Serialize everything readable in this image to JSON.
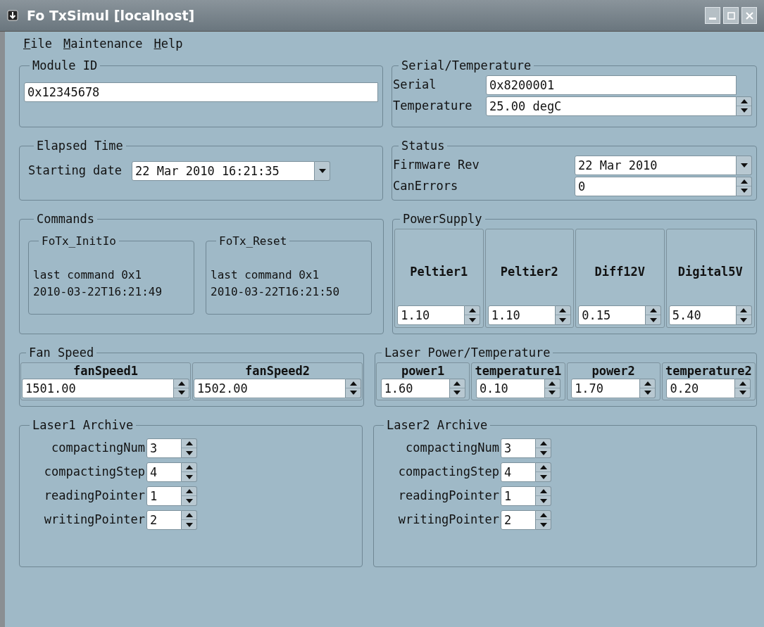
{
  "window": {
    "title": "Fo TxSimul [localhost]"
  },
  "menu": [
    "File",
    "Maintenance",
    "Help"
  ],
  "module_id": {
    "title": "Module ID",
    "value": "0x12345678"
  },
  "serial_temperature": {
    "title": "Serial/Temperature",
    "rows": [
      {
        "label": "Serial",
        "value": "0x8200001",
        "kind": "text"
      },
      {
        "label": "Temperature",
        "value": "25.00 degC",
        "kind": "spin"
      }
    ]
  },
  "elapsed_time": {
    "title": "Elapsed Time",
    "label": "Starting date",
    "value": "22 Mar 2010 16:21:35"
  },
  "status": {
    "title": "Status",
    "rows": [
      {
        "label": "Firmware Rev",
        "value": "22 Mar 2010",
        "kind": "combo"
      },
      {
        "label": "CanErrors",
        "value": "0",
        "kind": "spin"
      }
    ]
  },
  "commands": {
    "title": "Commands",
    "groups": [
      {
        "title": "FoTx_InitIo",
        "lines": [
          "last command 0x1",
          "2010-03-22T16:21:49"
        ]
      },
      {
        "title": "FoTx_Reset",
        "lines": [
          "last command 0x1",
          "2010-03-22T16:21:50"
        ]
      }
    ]
  },
  "power_supply": {
    "title": "PowerSupply",
    "channels": [
      {
        "label": "Peltier1",
        "value": "1.10"
      },
      {
        "label": "Peltier2",
        "value": "1.10"
      },
      {
        "label": "Diff12V",
        "value": "0.15"
      },
      {
        "label": "Digital5V",
        "value": "5.40"
      }
    ]
  },
  "fan_speed": {
    "title": "Fan Speed",
    "channels": [
      {
        "label": "fanSpeed1",
        "value": "1501.00"
      },
      {
        "label": "fanSpeed2",
        "value": "1502.00"
      }
    ]
  },
  "laser_power_temperature": {
    "title": "Laser Power/Temperature",
    "channels": [
      {
        "label": "power1",
        "value": "1.60"
      },
      {
        "label": "temperature1",
        "value": "0.10"
      },
      {
        "label": "power2",
        "value": "1.70"
      },
      {
        "label": "temperature2",
        "value": "0.20"
      }
    ]
  },
  "archives": [
    {
      "title": "Laser1 Archive",
      "rows": [
        {
          "label": "compactingNum",
          "value": "3"
        },
        {
          "label": "compactingStep",
          "value": "4"
        },
        {
          "label": "readingPointer",
          "value": "1"
        },
        {
          "label": "writingPointer",
          "value": "2"
        }
      ]
    },
    {
      "title": "Laser2 Archive",
      "rows": [
        {
          "label": "compactingNum",
          "value": "3"
        },
        {
          "label": "compactingStep",
          "value": "4"
        },
        {
          "label": "readingPointer",
          "value": "1"
        },
        {
          "label": "writingPointer",
          "value": "2"
        }
      ]
    }
  ]
}
